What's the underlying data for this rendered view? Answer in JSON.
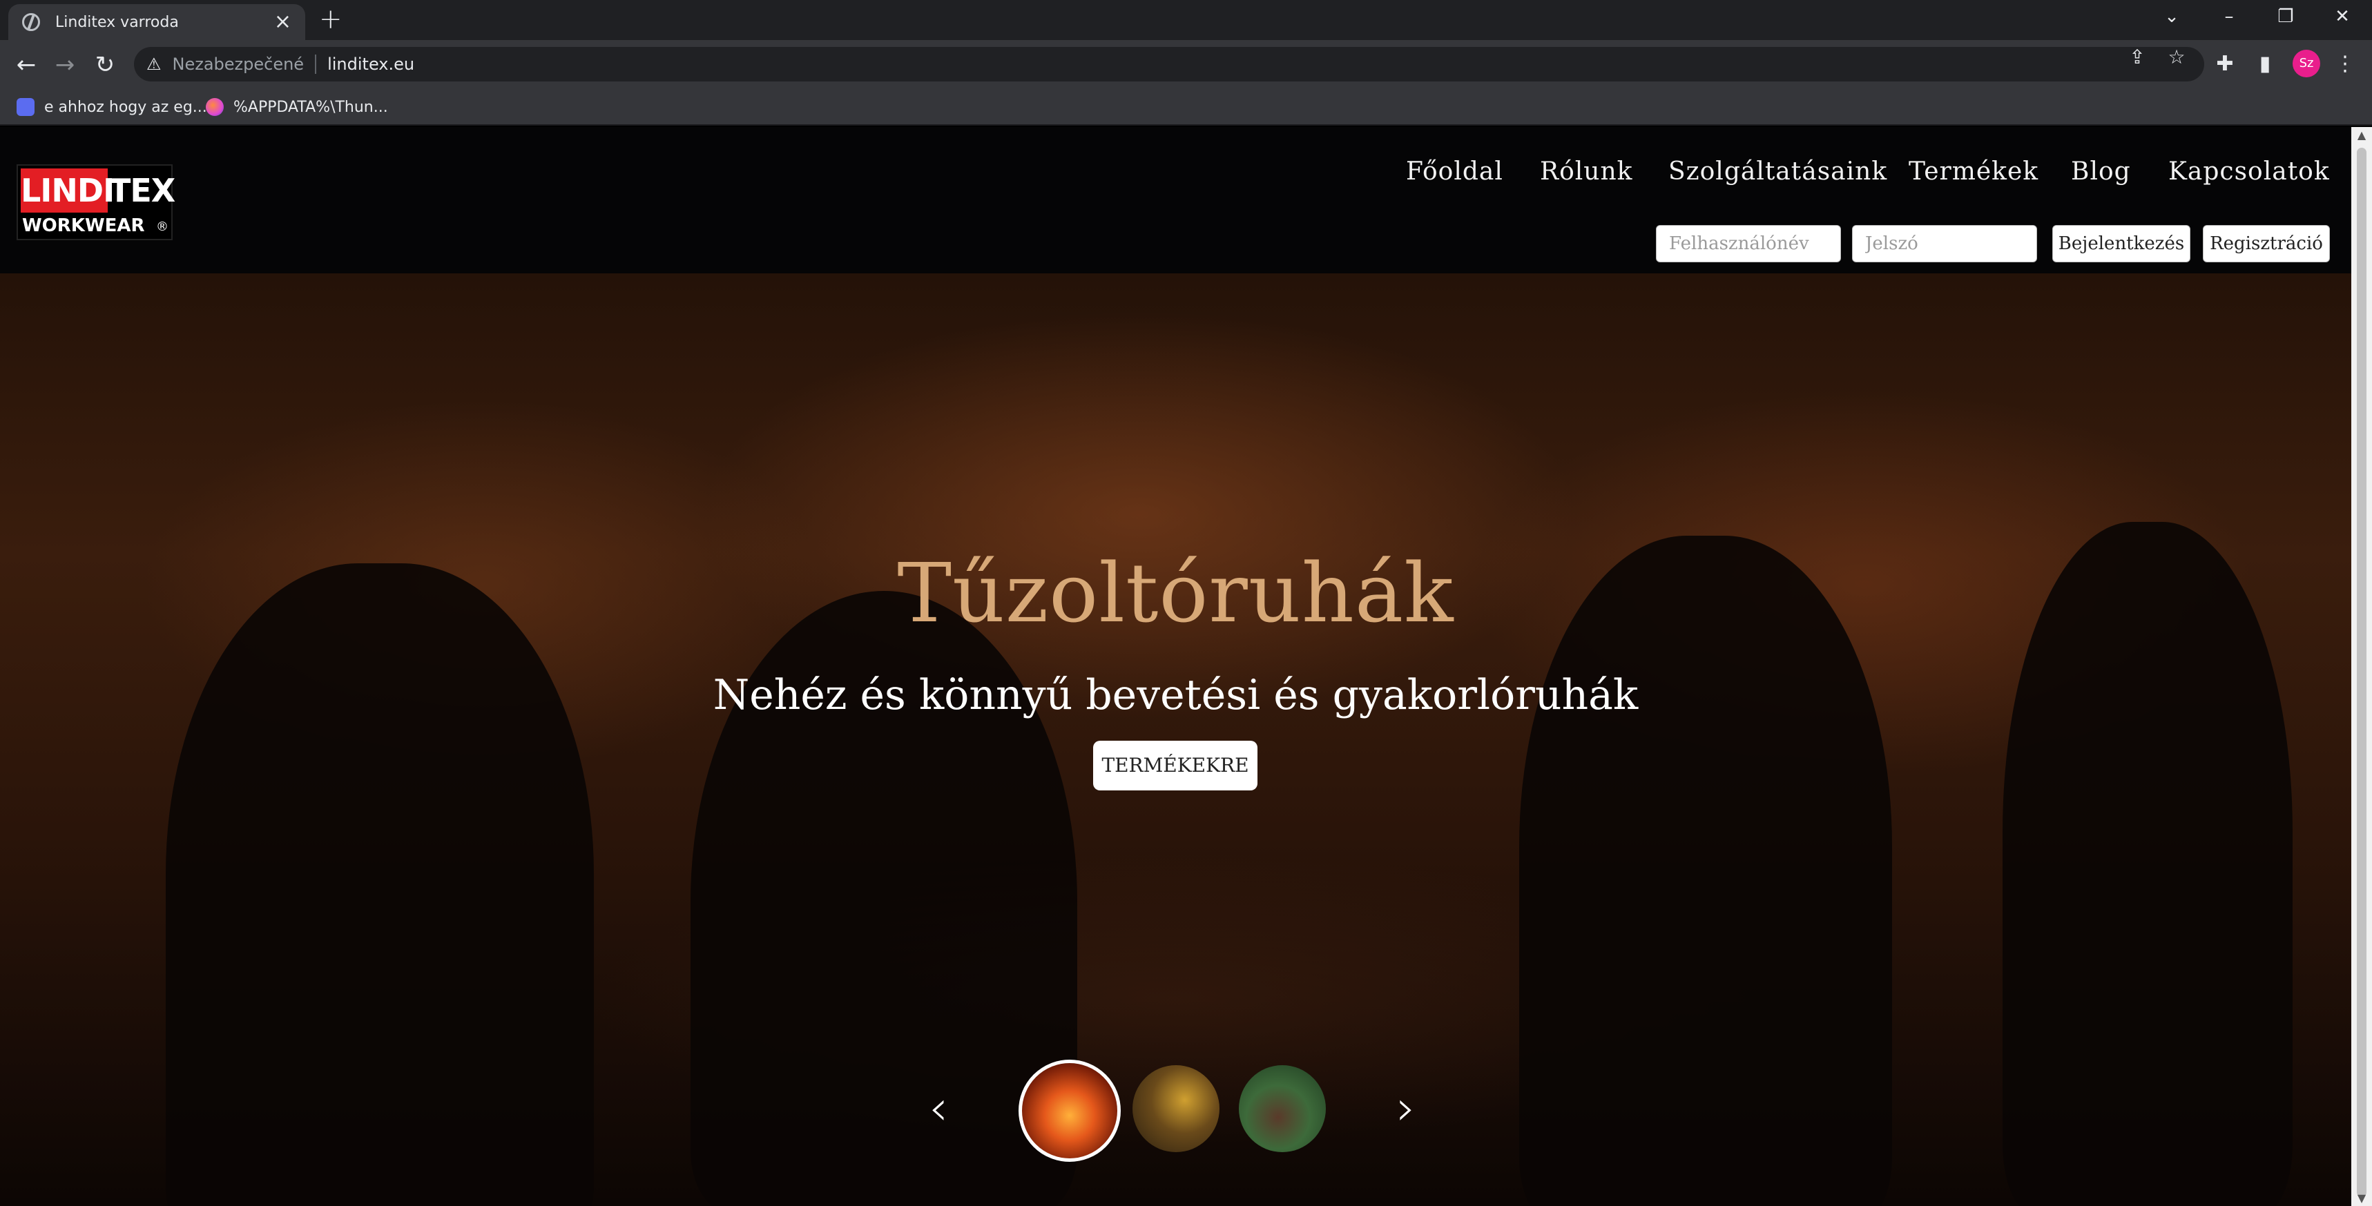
{
  "browser": {
    "tab_title": "Linditex varroda",
    "tab_close": "×",
    "new_tab": "+",
    "window_controls": [
      "⌄",
      "–",
      "❐",
      "✕"
    ],
    "security_label": "Nezabezpečené",
    "url": "linditex.eu",
    "profile_initials": "Sz",
    "bookmarks": [
      {
        "label": "e ahhoz hogy az eg...",
        "icon_color": "#5b6cf0"
      },
      {
        "label": "%APPDATA%\\Thun...",
        "icon_color": "#e04ad0"
      }
    ]
  },
  "site": {
    "logo": {
      "part1": "LINDI",
      "part2": "TEX",
      "part3": "WORKWEAR",
      "reg": "®",
      "brand_color": "#e31e24"
    },
    "nav": [
      "Főoldal",
      "Rólunk",
      "Szolgáltatásaink",
      "Termékek",
      "Blog",
      "Kapcsolatok"
    ],
    "login": {
      "username_placeholder": "Felhasználónév",
      "password_placeholder": "Jelszó",
      "login_label": "Bejelentkezés",
      "register_label": "Regisztráció"
    },
    "hero": {
      "title": "Tűzoltóruhák",
      "subtitle": "Nehéz és könnyű bevetési és gyakorlóruhák",
      "button": "TERMÉKEKRE",
      "prev_arrow": "‹",
      "next_arrow": "›",
      "title_color": "#d7a877"
    }
  }
}
